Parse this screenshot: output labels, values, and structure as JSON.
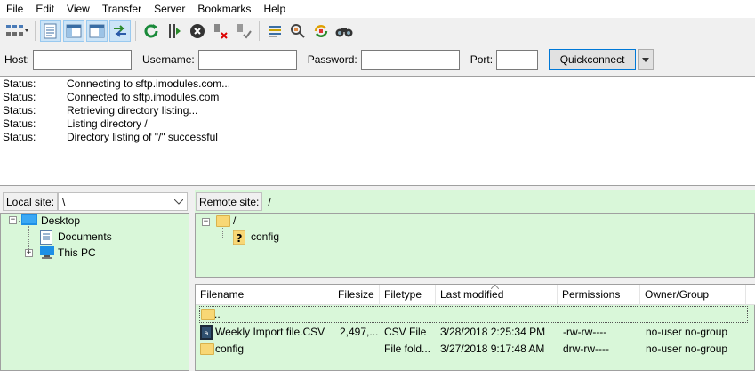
{
  "menu": [
    "File",
    "Edit",
    "View",
    "Transfer",
    "Server",
    "Bookmarks",
    "Help"
  ],
  "toolbar": {
    "icons": [
      "site-manager-icon",
      "toggle-message-log-icon",
      "toggle-local-tree-icon",
      "toggle-remote-tree-icon",
      "toggle-transfer-queue-icon",
      "refresh-icon",
      "process-queue-icon",
      "cancel-icon",
      "disconnect-icon",
      "reconnect-icon",
      "directory-filter-icon",
      "compare-directories-icon",
      "synchronized-browsing-icon",
      "search-icon"
    ]
  },
  "quickconnect": {
    "host_label": "Host:",
    "username_label": "Username:",
    "password_label": "Password:",
    "port_label": "Port:",
    "host_value": "",
    "username_value": "",
    "password_value": "",
    "port_value": "",
    "button_label": "Quickconnect"
  },
  "log": [
    {
      "key": "Status:",
      "msg": "Connecting to sftp.imodules.com..."
    },
    {
      "key": "Status:",
      "msg": "Connected to sftp.imodules.com"
    },
    {
      "key": "Status:",
      "msg": "Retrieving directory listing..."
    },
    {
      "key": "Status:",
      "msg": "Listing directory /"
    },
    {
      "key": "Status:",
      "msg": "Directory listing of \"/\" successful"
    }
  ],
  "local": {
    "label": "Local site:",
    "path": "\\",
    "tree": {
      "desktop": "Desktop",
      "documents": "Documents",
      "thispc": "This PC"
    }
  },
  "remote": {
    "label": "Remote site:",
    "path": "/",
    "tree": {
      "root": "/",
      "config": "config"
    }
  },
  "filelist": {
    "columns": [
      "Filename",
      "Filesize",
      "Filetype",
      "Last modified",
      "Permissions",
      "Owner/Group"
    ],
    "rows": [
      {
        "name": "..",
        "size": "",
        "type": "",
        "modified": "",
        "perms": "",
        "owner": ""
      },
      {
        "name": "Weekly Import file.CSV",
        "size": "2,497,...",
        "type": "CSV File",
        "modified": "3/28/2018 2:25:34 PM",
        "perms": "-rw-rw----",
        "owner": "no-user no-group"
      },
      {
        "name": "config",
        "size": "",
        "type": "File fold...",
        "modified": "3/27/2018 9:17:48 AM",
        "perms": "drw-rw----",
        "owner": "no-user no-group"
      }
    ]
  },
  "colors": {
    "panel_green": "#d9f7d9",
    "accent_blue": "#0078d7"
  }
}
